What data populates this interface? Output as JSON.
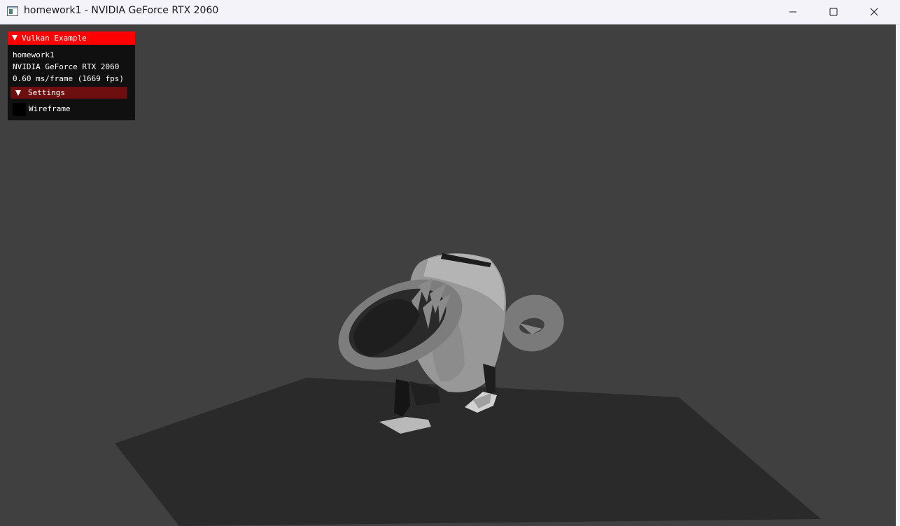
{
  "window": {
    "title": "homework1 - NVIDIA GeForce RTX 2060",
    "icon": "app-window-icon",
    "controls": [
      "minimize-icon",
      "maximize-icon",
      "close-icon"
    ]
  },
  "colors": {
    "titlebar": "#f3f3f9",
    "viewport_background": "#404040",
    "floor": "#2a2a2a",
    "overlay_header": "#ff0000",
    "overlay_background": "#101010",
    "settings_header": "#6e0e0e"
  },
  "overlay": {
    "title": "Vulkan Example",
    "app_name": "homework1",
    "device_name": "NVIDIA GeForce RTX 2060",
    "frame_stats": "0.60 ms/frame (1669 fps)",
    "settings": {
      "label": "Settings",
      "wireframe_label": "Wireframe",
      "wireframe_checked": false
    }
  }
}
